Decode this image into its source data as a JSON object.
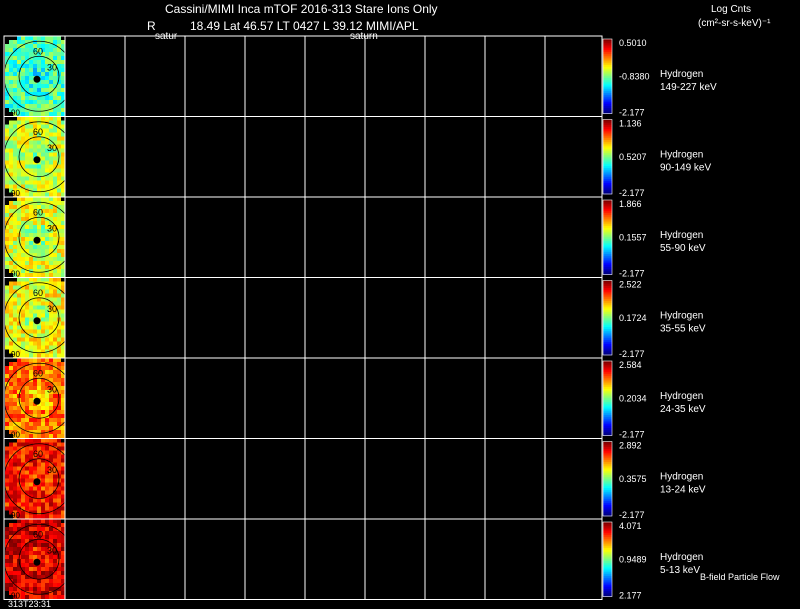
{
  "header": {
    "title": "Cassini/MIMI Inca mTOF  2016-313   Stare   Ions Only",
    "r_label": "R",
    "subtitle": "18.49 Lat 46.57 LT 0427 L        39.12  MIMI/APL",
    "left_tag": "satur",
    "mid_tag": "saturn",
    "units_line1": "Log Cnts",
    "units_line2": "(cm²-sr-s-keV)⁻¹"
  },
  "footer": {
    "timestamp": "313T23:31",
    "bfield_label": "B-field Particle Flow"
  },
  "skymap": {
    "ring_labels": [
      "60",
      "30"
    ],
    "bottom_label": "90"
  },
  "chart_data": {
    "type": "heatmap",
    "title": "Cassini/MIMI Inca mTOF  2016-313   Stare   Ions Only",
    "colorbar_label": "Log Cnts (cm²-sr-s-keV)⁻¹",
    "grid": true,
    "panels": [
      {
        "species": "Hydrogen",
        "energy": "149-227 keV",
        "cbar": [
          "0.5010",
          "-0.8380",
          "-2.177"
        ],
        "level": 0.45
      },
      {
        "species": "Hydrogen",
        "energy": "90-149 keV",
        "cbar": [
          "1.136",
          "0.5207",
          "-2.177"
        ],
        "level": 0.58
      },
      {
        "species": "Hydrogen",
        "energy": "55-90 keV",
        "cbar": [
          "1.866",
          "0.1557",
          "-2.177"
        ],
        "level": 0.6
      },
      {
        "species": "Hydrogen",
        "energy": "35-55 keV",
        "cbar": [
          "2.522",
          "0.1724",
          "-2.177"
        ],
        "level": 0.62
      },
      {
        "species": "Hydrogen",
        "energy": "24-35 keV",
        "cbar": [
          "2.584",
          "0.2034",
          "-2.177"
        ],
        "level": 0.76
      },
      {
        "species": "Hydrogen",
        "energy": "13-24 keV",
        "cbar": [
          "2.892",
          "0.3575",
          "-2.177"
        ],
        "level": 0.86
      },
      {
        "species": "Hydrogen",
        "energy": "5-13 keV",
        "cbar": [
          "4.071",
          "0.9489",
          "2.177"
        ],
        "level": 0.92
      }
    ]
  }
}
